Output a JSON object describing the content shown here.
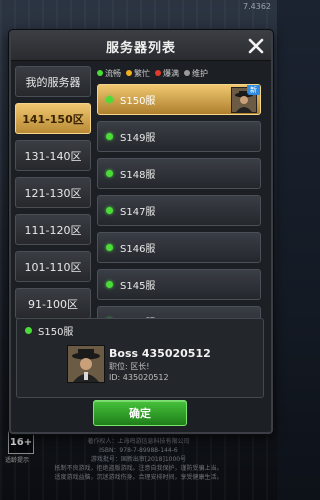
{
  "background": {
    "version": "7.4362",
    "age_rating": "16+",
    "age_label": "适龄提示",
    "footer_lines": [
      "出版单位：上海科学技术出版社有限公司",
      "著作权人：上海鸣游信息科技有限公司",
      "ISBN：978-7-89988-144-6",
      "游戏批号：国新出审[2018]1000号",
      "抵制不良游戏，拒绝盗版游戏。注意自我保护，谨防受骗上当。",
      "适度游戏益脑，沉迷游戏伤身。合理安排时间，享受健康生活。"
    ]
  },
  "panel": {
    "title": "服务器列表",
    "close_icon": "close-icon"
  },
  "sidebar": {
    "items": [
      {
        "label": "我的服务器",
        "active": false
      },
      {
        "label": "141-150区",
        "active": true
      },
      {
        "label": "131-140区",
        "active": false
      },
      {
        "label": "121-130区",
        "active": false
      },
      {
        "label": "111-120区",
        "active": false
      },
      {
        "label": "101-110区",
        "active": false
      },
      {
        "label": "91-100区",
        "active": false
      }
    ]
  },
  "legend": [
    {
      "label": "流畅",
      "color": "#4bdc3a"
    },
    {
      "label": "繁忙",
      "color": "#f0b020"
    },
    {
      "label": "爆满",
      "color": "#e03a2a"
    },
    {
      "label": "维护",
      "color": "#9a9a9a"
    }
  ],
  "servers": [
    {
      "name": "S150服",
      "status_color": "#4bdc3a",
      "selected": true,
      "new_tag": "新"
    },
    {
      "name": "S149服",
      "status_color": "#4bdc3a",
      "selected": false
    },
    {
      "name": "S148服",
      "status_color": "#4bdc3a",
      "selected": false
    },
    {
      "name": "S147服",
      "status_color": "#4bdc3a",
      "selected": false
    },
    {
      "name": "S146服",
      "status_color": "#4bdc3a",
      "selected": false
    },
    {
      "name": "S145服",
      "status_color": "#4bdc3a",
      "selected": false
    },
    {
      "name": "S144服",
      "status_color": "#4bdc3a",
      "selected": false
    }
  ],
  "selected_info": {
    "server": "S150服",
    "player_name": "Boss 435020512",
    "position": "职位: 区长!",
    "id_text": "ID: 435020512"
  },
  "confirm_label": "确定"
}
